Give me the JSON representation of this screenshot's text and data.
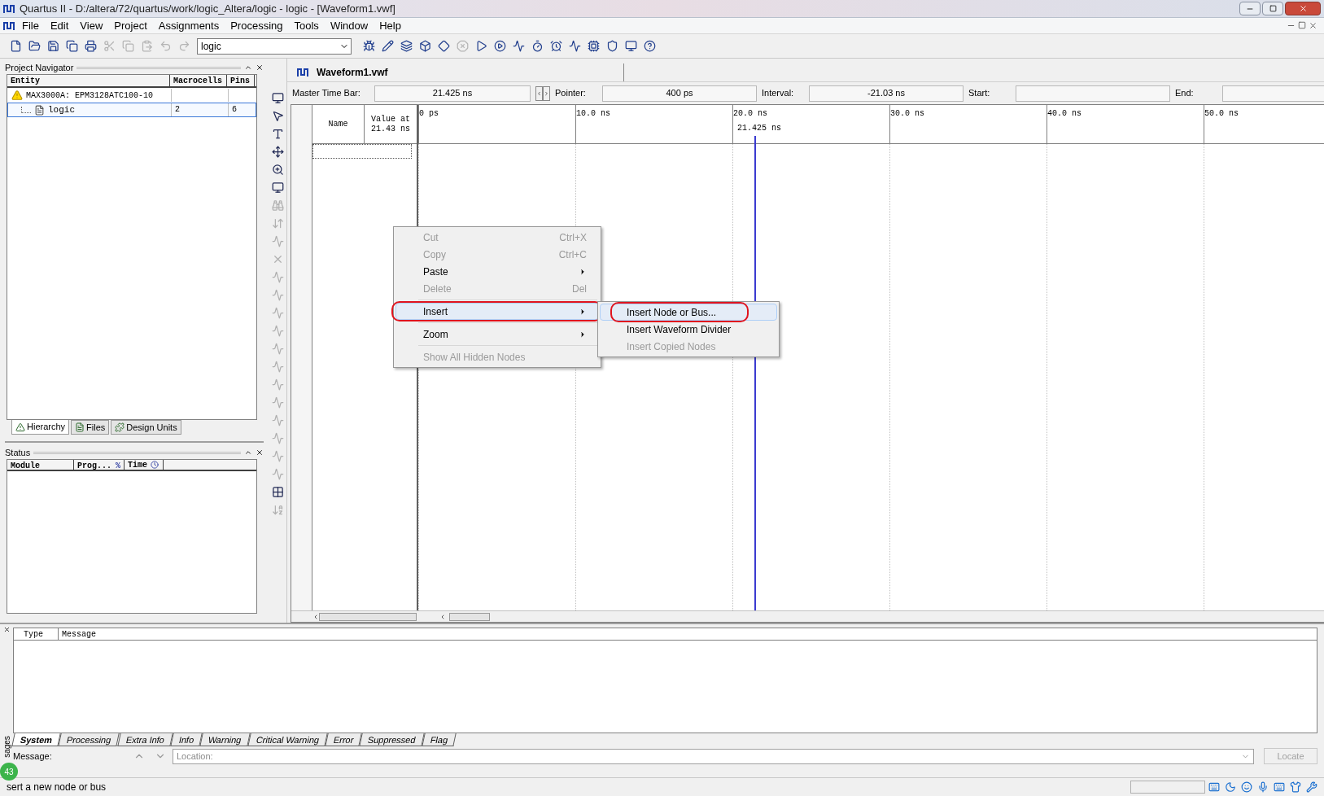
{
  "window": {
    "title": "Quartus II - D:/altera/72/quartus/work/logic_Altera/logic - logic - [Waveform1.vwf]"
  },
  "menu_bar": [
    "File",
    "Edit",
    "View",
    "Project",
    "Assignments",
    "Processing",
    "Tools",
    "Window",
    "Help"
  ],
  "toolbar": {
    "buttons_left": [
      {
        "disabled": false
      },
      {
        "disabled": false
      },
      {
        "disabled": false
      },
      {
        "disabled": false
      },
      {
        "disabled": false
      },
      {
        "disabled": true
      },
      {
        "disabled": true
      },
      {
        "disabled": true
      },
      {
        "disabled": true
      },
      {
        "disabled": true
      }
    ],
    "combo_value": "logic",
    "buttons_right": [
      {
        "disabled": false
      },
      {
        "disabled": false
      },
      {
        "disabled": false
      },
      {
        "disabled": false
      },
      {
        "disabled": false
      },
      {
        "disabled": true
      },
      {
        "disabled": false
      },
      {
        "disabled": false
      },
      {
        "disabled": false
      },
      {
        "disabled": false
      },
      {
        "disabled": false
      },
      {
        "disabled": false
      },
      {
        "disabled": false
      },
      {
        "disabled": false
      },
      {
        "disabled": false
      },
      {
        "disabled": false
      }
    ]
  },
  "project_navigator": {
    "title": "Project Navigator",
    "columns": [
      "Entity",
      "Macrocells",
      "Pins"
    ],
    "rows": [
      {
        "entity": "MAX3000A: EPM3128ATC100-10",
        "macrocells": "",
        "pins": "",
        "selected": false,
        "children": [
          {
            "entity": "logic",
            "macrocells": "2",
            "pins": "6",
            "selected": true
          }
        ]
      }
    ],
    "tabs": [
      {
        "label": "Hierarchy",
        "selected": true
      },
      {
        "label": "Files",
        "selected": false
      },
      {
        "label": "Design Units",
        "selected": false
      }
    ]
  },
  "status_panel": {
    "title": "Status",
    "columns": [
      "Module",
      "Prog...",
      "Time"
    ],
    "percent_symbol": "%"
  },
  "vertical_tools": [
    {
      "disabled": false
    },
    {
      "disabled": false
    },
    {
      "disabled": false
    },
    {
      "disabled": false
    },
    {
      "disabled": false
    },
    {
      "disabled": false
    },
    {
      "disabled": true
    },
    {
      "disabled": true
    },
    {
      "disabled": true
    },
    {
      "disabled": true
    },
    {
      "disabled": true
    },
    {
      "disabled": true
    },
    {
      "disabled": true
    },
    {
      "disabled": true
    },
    {
      "disabled": true
    },
    {
      "disabled": true
    },
    {
      "disabled": true
    },
    {
      "disabled": true
    },
    {
      "disabled": true
    },
    {
      "disabled": true
    },
    {
      "disabled": true
    },
    {
      "disabled": true
    },
    {
      "disabled": false
    },
    {
      "disabled": true
    }
  ],
  "waveform": {
    "tab": "Waveform1.vwf",
    "time_bar": [
      {
        "label": "Master Time Bar:",
        "value": "21.425 ns"
      },
      {
        "label": "Pointer:",
        "value": "400 ps"
      },
      {
        "label": "Interval:",
        "value": "-21.03 ns"
      },
      {
        "label": "Start:"
      },
      {
        "label": "End:"
      }
    ],
    "name_column": "Name",
    "value_column": "Value at 21.43 ns",
    "ticks": [
      "0 ps",
      "10.0 ns",
      "20.0 ns",
      "30.0 ns",
      "40.0 ns",
      "50.0 ns"
    ],
    "cursor_label": "21.425 ns"
  },
  "context_menu": {
    "items": [
      {
        "kind": "item",
        "label": "Cut",
        "shortcut": "Ctrl+X",
        "disabled": true,
        "submenu": false,
        "selected": false,
        "circled": false
      },
      {
        "kind": "item",
        "label": "Copy",
        "shortcut": "Ctrl+C",
        "disabled": true,
        "submenu": false,
        "selected": false,
        "circled": false
      },
      {
        "kind": "item",
        "label": "Paste",
        "disabled": false,
        "submenu": true,
        "selected": false,
        "circled": false
      },
      {
        "kind": "item",
        "label": "Delete",
        "shortcut": "Del",
        "disabled": true,
        "submenu": false,
        "selected": false,
        "circled": false
      },
      {
        "kind": "separator"
      },
      {
        "kind": "item",
        "label": "Insert",
        "disabled": false,
        "submenu": true,
        "selected": true,
        "circled": true
      },
      {
        "kind": "separator"
      },
      {
        "kind": "item",
        "label": "Zoom",
        "disabled": false,
        "submenu": true,
        "selected": false,
        "circled": false
      },
      {
        "kind": "separator"
      },
      {
        "kind": "item",
        "label": "Show All Hidden Nodes",
        "disabled": true,
        "submenu": false,
        "selected": false,
        "circled": false
      }
    ],
    "submenu": [
      {
        "label": "Insert Node or Bus...",
        "disabled": false,
        "selected": true,
        "circled": true
      },
      {
        "label": "Insert Waveform Divider",
        "disabled": false,
        "selected": false,
        "circled": false
      },
      {
        "label": "Insert Copied Nodes",
        "disabled": true,
        "selected": false,
        "circled": false
      }
    ]
  },
  "messages": {
    "side_label": "sages",
    "columns": [
      "Type",
      "Message"
    ],
    "tabs": [
      {
        "label": "System",
        "selected": true
      },
      {
        "label": "Processing",
        "selected": false
      },
      {
        "label": "Extra Info",
        "selected": false
      },
      {
        "label": "Info",
        "selected": false
      },
      {
        "label": "Warning",
        "selected": false
      },
      {
        "label": "Critical Warning",
        "selected": false
      },
      {
        "label": "Error",
        "selected": false
      },
      {
        "label": "Suppressed",
        "selected": false
      },
      {
        "label": "Flag",
        "selected": false
      }
    ],
    "message_label": "Message:",
    "location_placeholder": "Location:",
    "locate_button": "Locate",
    "badge": "43"
  },
  "status_bar": {
    "text": "sert a new node or bus"
  }
}
